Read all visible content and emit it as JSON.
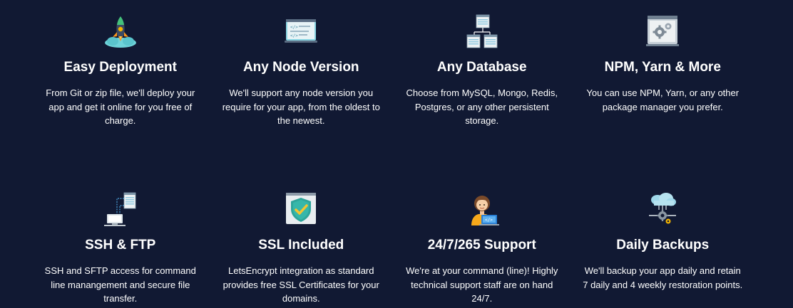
{
  "features": [
    {
      "icon": "rocket-icon",
      "title": "Easy Deployment",
      "description": "From Git or zip file, we'll deploy your app and get it online for you free of charge."
    },
    {
      "icon": "code-window-icon",
      "title": "Any Node Version",
      "description": "We'll support any node version you require for your app, from the oldest to the newest."
    },
    {
      "icon": "database-icon",
      "title": "Any Database",
      "description": "Choose from MySQL, Mongo, Redis, Postgres, or any other persistent storage."
    },
    {
      "icon": "package-gear-icon",
      "title": "NPM, Yarn & More",
      "description": "You can use NPM, Yarn, or any other package manager you prefer."
    },
    {
      "icon": "ssh-ftp-icon",
      "title": "SSH & FTP",
      "description": "SSH and SFTP access for command line manangement and secure file transfer."
    },
    {
      "icon": "shield-check-icon",
      "title": "SSL Included",
      "description": "LetsEncrypt integration as standard provides free SSL Certificates for your domains."
    },
    {
      "icon": "support-person-icon",
      "title": "24/7/265 Support",
      "description": "We're at your command (line)! Highly technical support staff are on hand 24/7."
    },
    {
      "icon": "cloud-backup-icon",
      "title": "Daily Backups",
      "description": "We'll backup your app daily and retain 7 daily and 4 weekly restoration points."
    }
  ]
}
